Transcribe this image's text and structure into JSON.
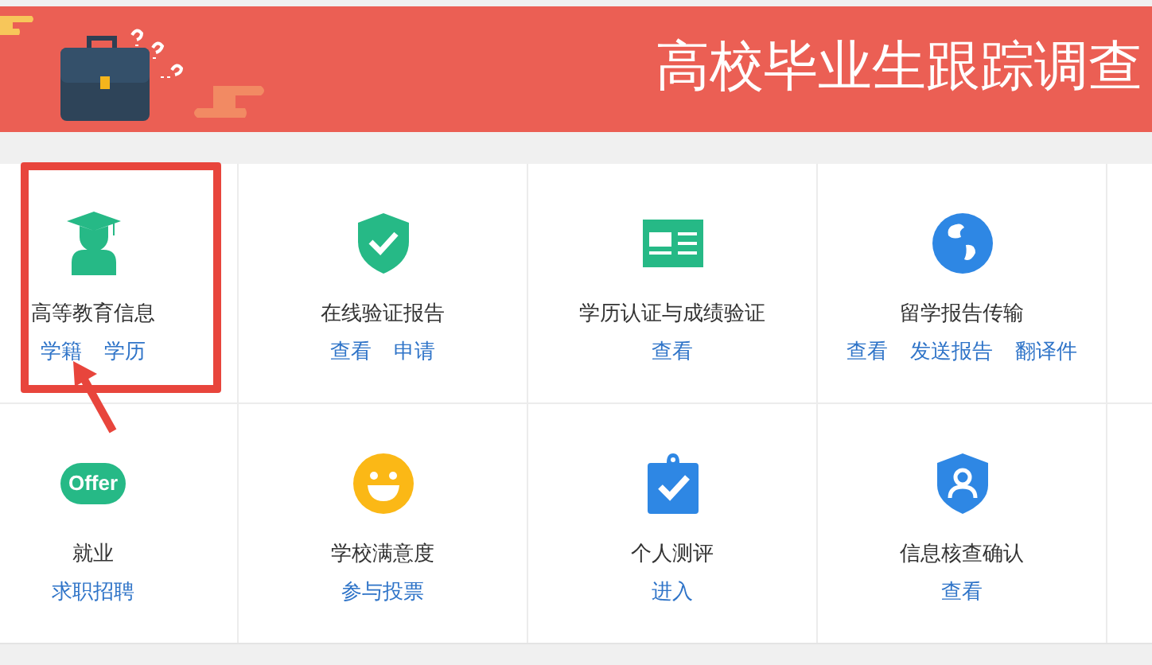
{
  "banner": {
    "title": "高校毕业生跟踪调查"
  },
  "tiles": [
    {
      "kind": "graduate",
      "label": "高等教育信息",
      "links": [
        "学籍",
        "学历"
      ],
      "selected": true
    },
    {
      "kind": "shield-check",
      "label": "在线验证报告",
      "links": [
        "查看",
        "申请"
      ],
      "selected": false
    },
    {
      "kind": "id-card",
      "label": "学历认证与成绩验证",
      "links": [
        "查看"
      ],
      "selected": false
    },
    {
      "kind": "globe",
      "label": "留学报告传输",
      "links": [
        "查看",
        "发送报告",
        "翻译件"
      ],
      "selected": false
    },
    {
      "kind": "offer",
      "icon_text": "Offer",
      "label": "就业",
      "links": [
        "求职招聘"
      ],
      "selected": false
    },
    {
      "kind": "smiley",
      "label": "学校满意度",
      "links": [
        "参与投票"
      ],
      "selected": false
    },
    {
      "kind": "clipboard",
      "label": "个人测评",
      "links": [
        "进入"
      ],
      "selected": false
    },
    {
      "kind": "shield-user",
      "label": "信息核查确认",
      "links": [
        "查看"
      ],
      "selected": false
    }
  ]
}
